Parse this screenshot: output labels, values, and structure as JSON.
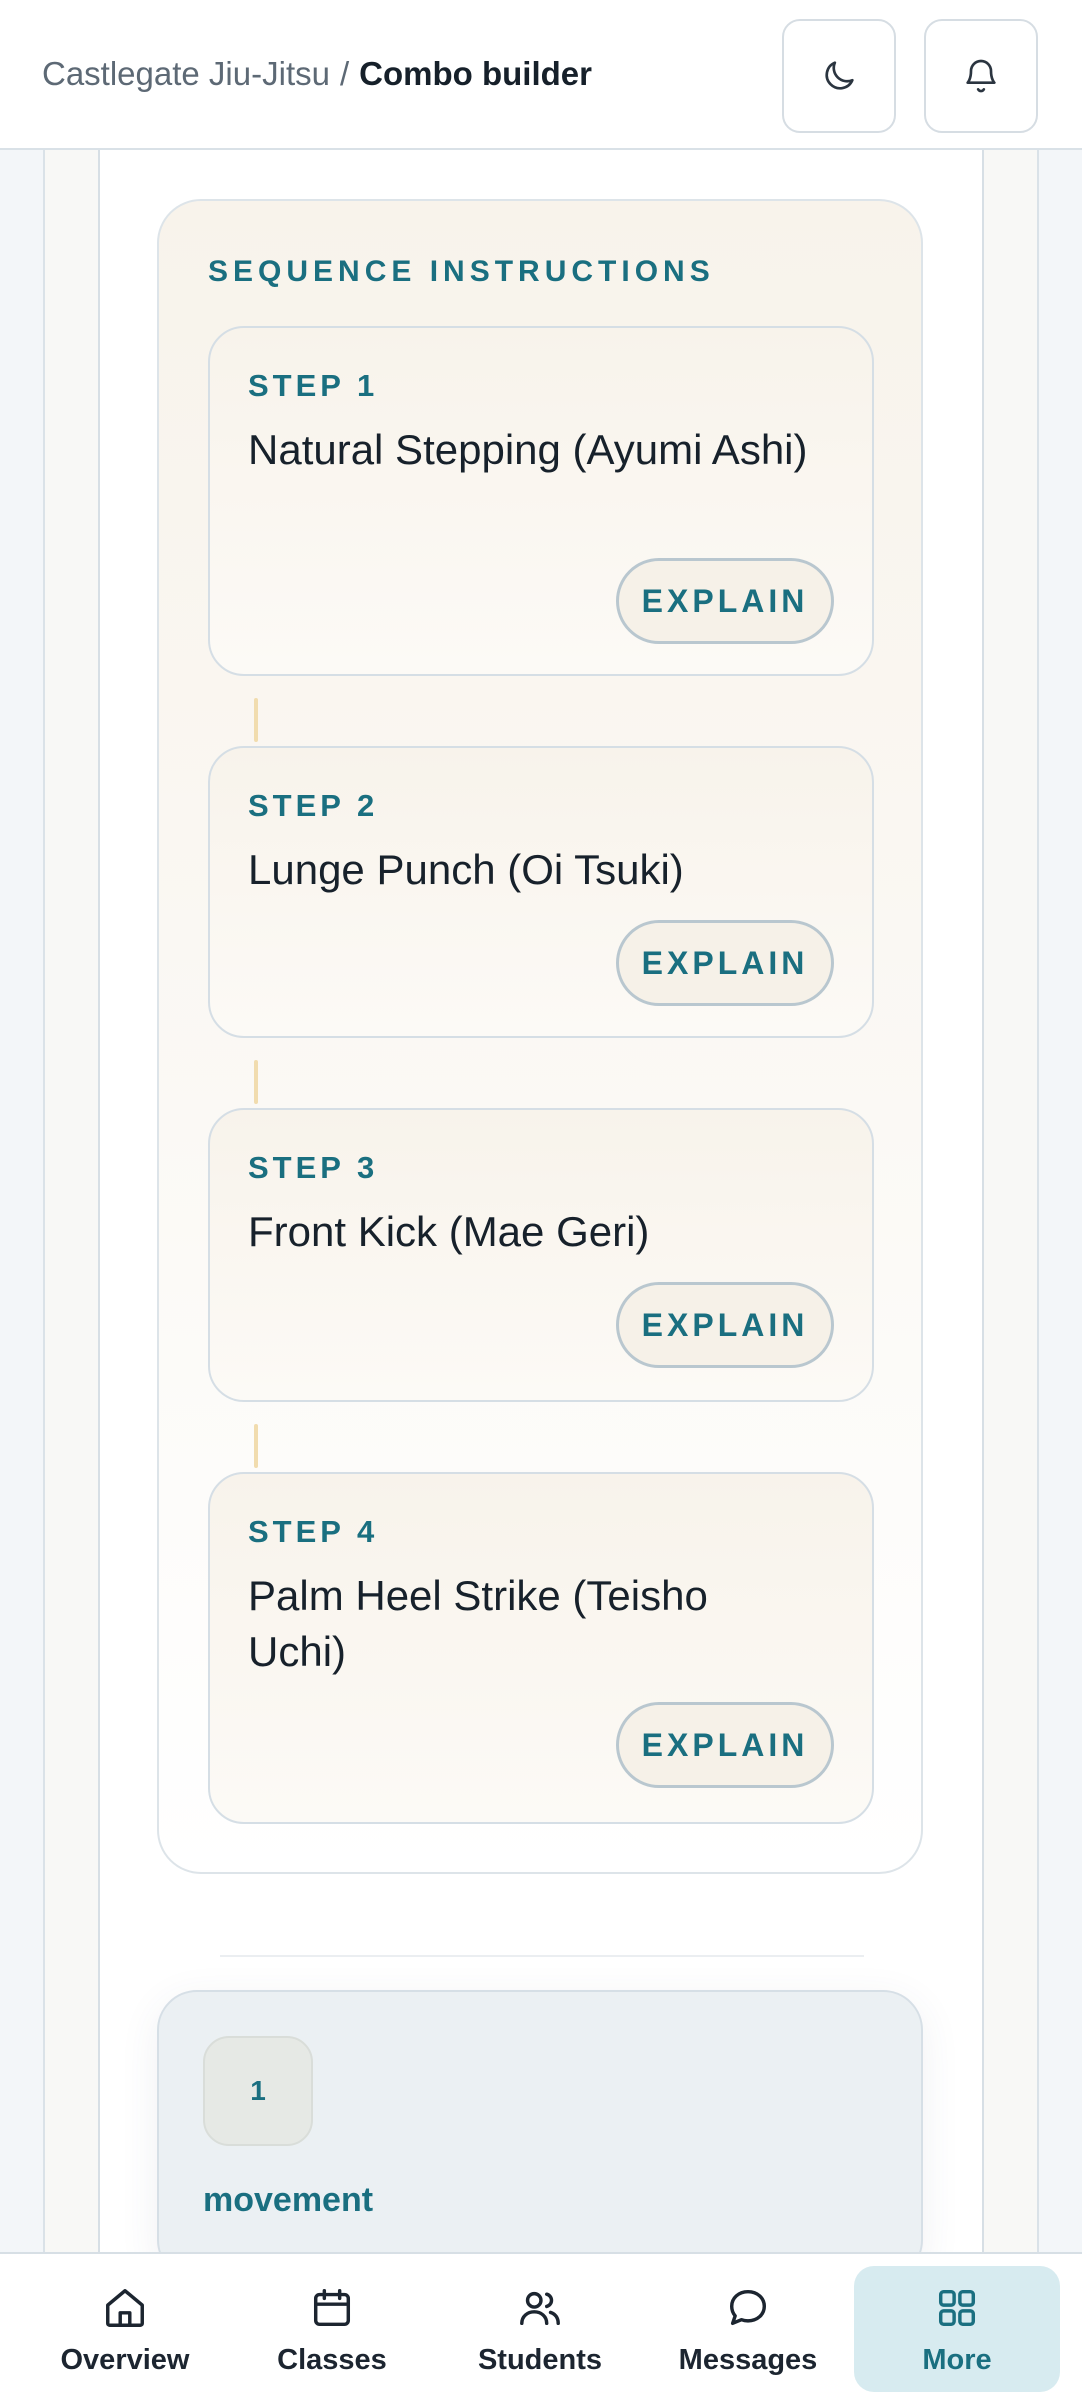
{
  "header": {
    "breadcrumb_parent": "Castlegate Jiu-Jitsu",
    "breadcrumb_separator": "/",
    "breadcrumb_current": "Combo builder",
    "theme_toggle_icon": "moon-icon",
    "notifications_icon": "bell-icon"
  },
  "sequence": {
    "title": "SEQUENCE INSTRUCTIONS",
    "steps": [
      {
        "label": "STEP 1",
        "text": "Natural Stepping (Ayumi Ashi)",
        "action": "EXPLAIN"
      },
      {
        "label": "STEP 2",
        "text": "Lunge Punch (Oi Tsuki)",
        "action": "EXPLAIN"
      },
      {
        "label": "STEP 3",
        "text": "Front Kick (Mae Geri)",
        "action": "EXPLAIN"
      },
      {
        "label": "STEP 4",
        "text": "Palm Heel Strike (Teisho Uchi)",
        "action": "EXPLAIN"
      }
    ]
  },
  "movement": {
    "badge": "1",
    "label": "movement"
  },
  "bottom_nav": {
    "items": [
      {
        "label": "Overview",
        "icon": "home-icon"
      },
      {
        "label": "Classes",
        "icon": "calendar-icon"
      },
      {
        "label": "Students",
        "icon": "users-icon"
      },
      {
        "label": "Messages",
        "icon": "chat-bubble-icon"
      },
      {
        "label": "More",
        "icon": "grid-icon",
        "active": true
      }
    ]
  },
  "colors": {
    "accent": "#1a6f80",
    "card_warm": "#f8f3eb",
    "active_nav_bg": "#d7ebf0",
    "connector": "#f1dcae"
  }
}
